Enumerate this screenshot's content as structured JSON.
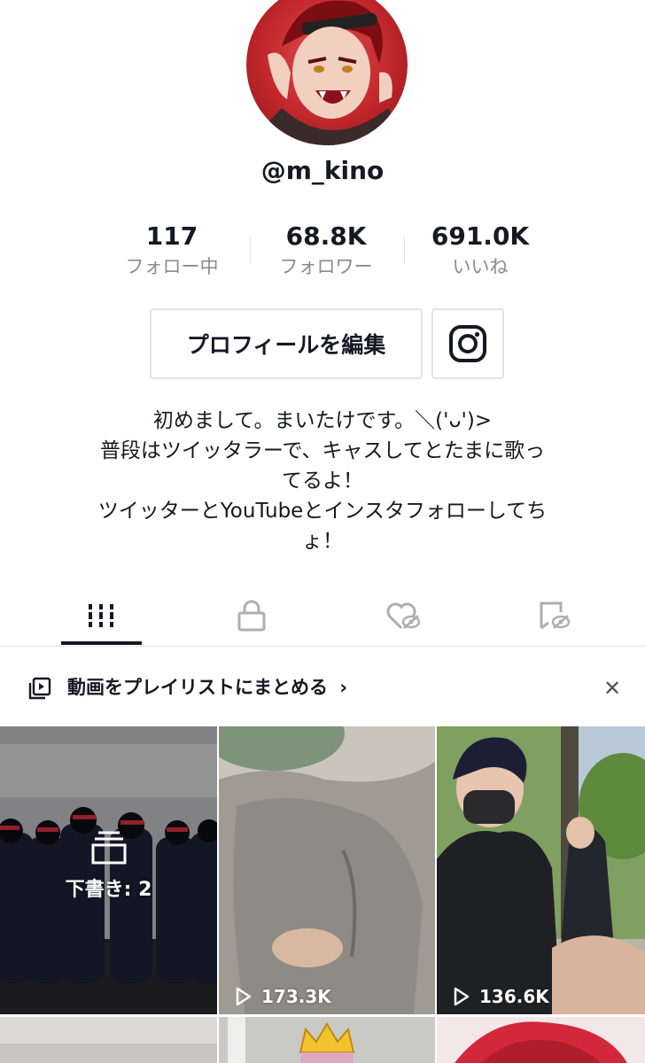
{
  "profile": {
    "handle": "@m_kino"
  },
  "stats": [
    {
      "value": "117",
      "label": "フォロー中"
    },
    {
      "value": "68.8K",
      "label": "フォロワー"
    },
    {
      "value": "691.0K",
      "label": "いいね"
    }
  ],
  "actions": {
    "edit_profile_label": "プロフィールを編集",
    "instagram_icon": "instagram-icon"
  },
  "bio": {
    "lines": [
      "初めまして。まいたけです。＼('ᴗ')>",
      "普段はツイッタラーで、キャスしてとたまに歌っ",
      "てるよ！",
      "ツイッターとYouTubeとインスタフォローしてち",
      "ょ！"
    ]
  },
  "tabs": [
    {
      "icon": "grid-icon",
      "active": true
    },
    {
      "icon": "lock-icon",
      "active": false
    },
    {
      "icon": "liked-hidden-icon",
      "active": false
    },
    {
      "icon": "bookmark-hidden-icon",
      "active": false
    }
  ],
  "playlist_banner": {
    "label": "動画をプレイリストにまとめる",
    "chevron": "›",
    "close": "✕"
  },
  "videos": [
    {
      "type": "drafts",
      "label": "下書き: 2"
    },
    {
      "type": "video",
      "views": "173.3K"
    },
    {
      "type": "video",
      "views": "136.6K"
    }
  ],
  "colors": {
    "text": "#161823",
    "muted": "#8a8b91",
    "divider": "#e3e3e4",
    "inactive_icon": "#aeaeb2"
  }
}
